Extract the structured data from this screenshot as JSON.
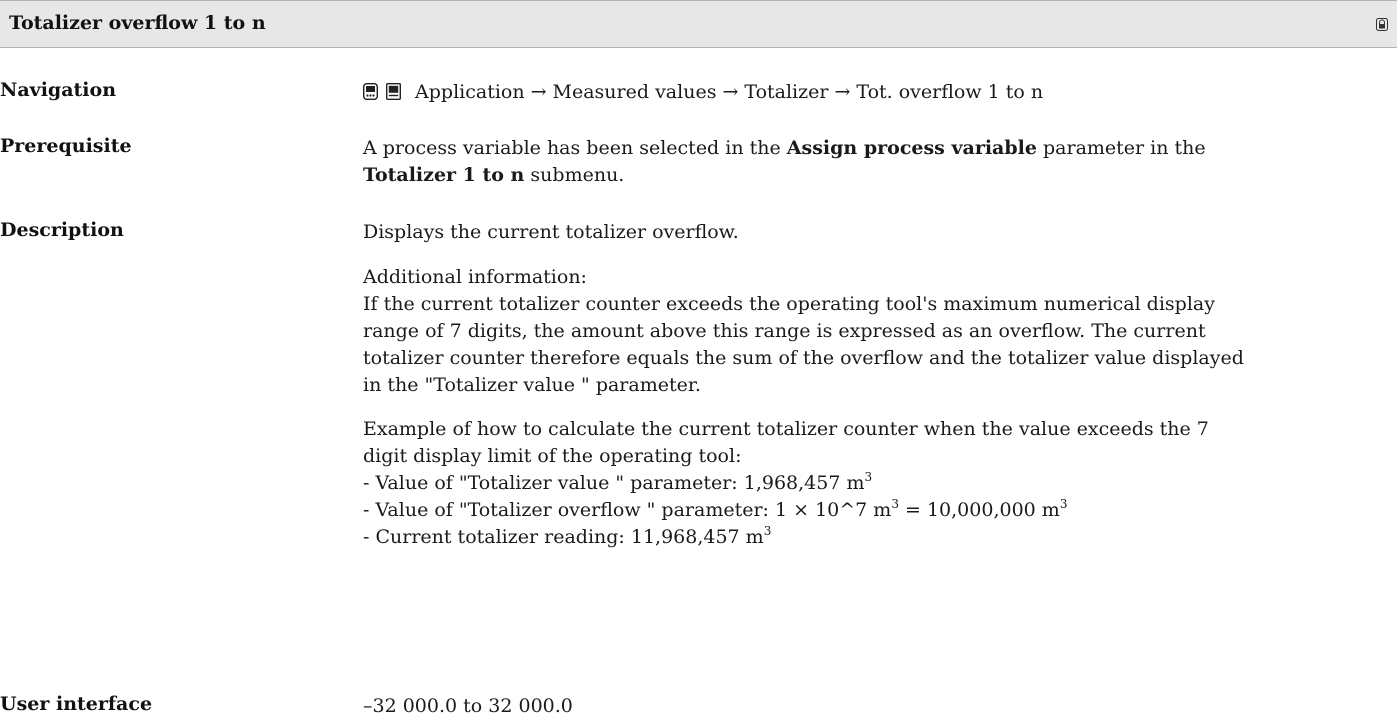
{
  "header": {
    "title": "Totalizer overflow 1 to n"
  },
  "navigation": {
    "label": "Navigation",
    "path": [
      "Application",
      "Measured values",
      "Totalizer",
      "Tot. overflow 1 to n"
    ],
    "separator": "→"
  },
  "prerequisite": {
    "label": "Prerequisite",
    "text_1": "A process variable has been selected in the",
    "bold_1": "Assign process variable",
    "text_2": "parameter in the",
    "bold_2": "Totalizer 1 to n",
    "text_3": "submenu."
  },
  "description": {
    "label": "Description",
    "intro": "Displays the current totalizer overflow.",
    "additional_heading": "Additional information:",
    "additional_line_1": "If the current totalizer counter exceeds the operating tool's maximum numerical display",
    "additional_line_2": "range of 7 digits, the amount above this range is expressed as an overflow. The current",
    "additional_line_3": "totalizer counter therefore equals the sum of the overflow and the totalizer value displayed",
    "additional_line_4": "in the \"Totalizer value \" parameter.",
    "example_line_1": "Example of how to calculate the current totalizer counter when the value exceeds the 7",
    "example_line_2": "digit display limit of the operating tool:",
    "item_1": "- Value of \"Totalizer value \" parameter: 1,968,457 m",
    "item_2a": "- Value of \"Totalizer overflow \" parameter: 1 × 10^7 m",
    "item_2b": " = 10,000,000 m",
    "item_3": "- Current totalizer reading: 11,968,457 m",
    "superscript": "3"
  },
  "user_interface": {
    "label": "User interface",
    "value": "–32 000.0 to 32 000.0"
  },
  "icons": {
    "header": "lock-icon",
    "navigation": [
      "display-icon",
      "keypad-icon"
    ]
  }
}
